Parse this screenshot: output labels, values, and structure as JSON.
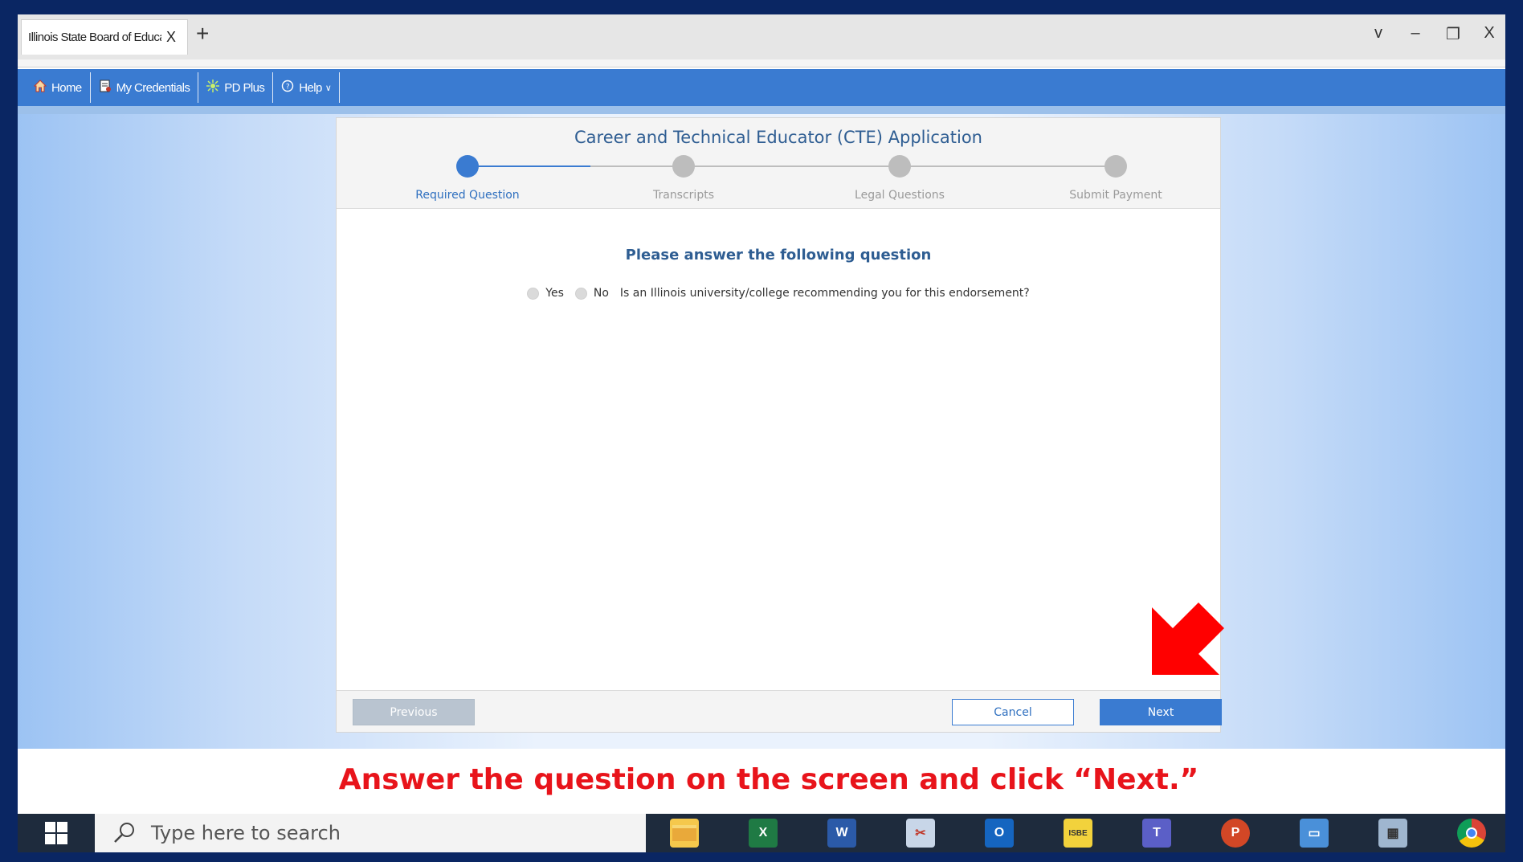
{
  "browser": {
    "tab_title": "Illinois State Board of Education",
    "tab_close": "X",
    "new_tab": "+",
    "controls": {
      "chevron": "v",
      "minimize": "–",
      "restore": "❐",
      "close": "X"
    }
  },
  "nav": {
    "items": [
      {
        "label": "Home",
        "icon": "home-icon"
      },
      {
        "label": "My Credentials",
        "icon": "credentials-icon"
      },
      {
        "label": "PD Plus",
        "icon": "pd-plus-icon"
      },
      {
        "label": "Help",
        "icon": "help-icon"
      }
    ]
  },
  "application": {
    "title": "Career and Technical Educator (CTE) Application",
    "steps": [
      {
        "label": "Required Question",
        "active": true
      },
      {
        "label": "Transcripts",
        "active": false
      },
      {
        "label": "Legal Questions",
        "active": false
      },
      {
        "label": "Submit Payment",
        "active": false
      }
    ],
    "question_heading": "Please answer the following question",
    "question": {
      "yes_label": "Yes",
      "no_label": "No",
      "text": "Is an Illinois university/college recommending you for this endorsement?"
    },
    "buttons": {
      "previous": "Previous",
      "cancel": "Cancel",
      "next": "Next"
    }
  },
  "instruction": "Answer the question on the screen and click “Next.”",
  "taskbar": {
    "search_placeholder": "Type here to search",
    "apps": [
      "file-explorer-icon",
      "excel-icon",
      "word-icon",
      "snipping-tool-icon",
      "outlook-icon",
      "isbe-icon",
      "teams-icon",
      "powerpoint-icon",
      "laptop-icon",
      "calculator-icon",
      "chrome-icon"
    ]
  },
  "colors": {
    "accent": "#3a7bd1",
    "title_blue": "#2e5d92",
    "instruction_red": "#e8141b",
    "arrow_red": "#ff0000"
  }
}
